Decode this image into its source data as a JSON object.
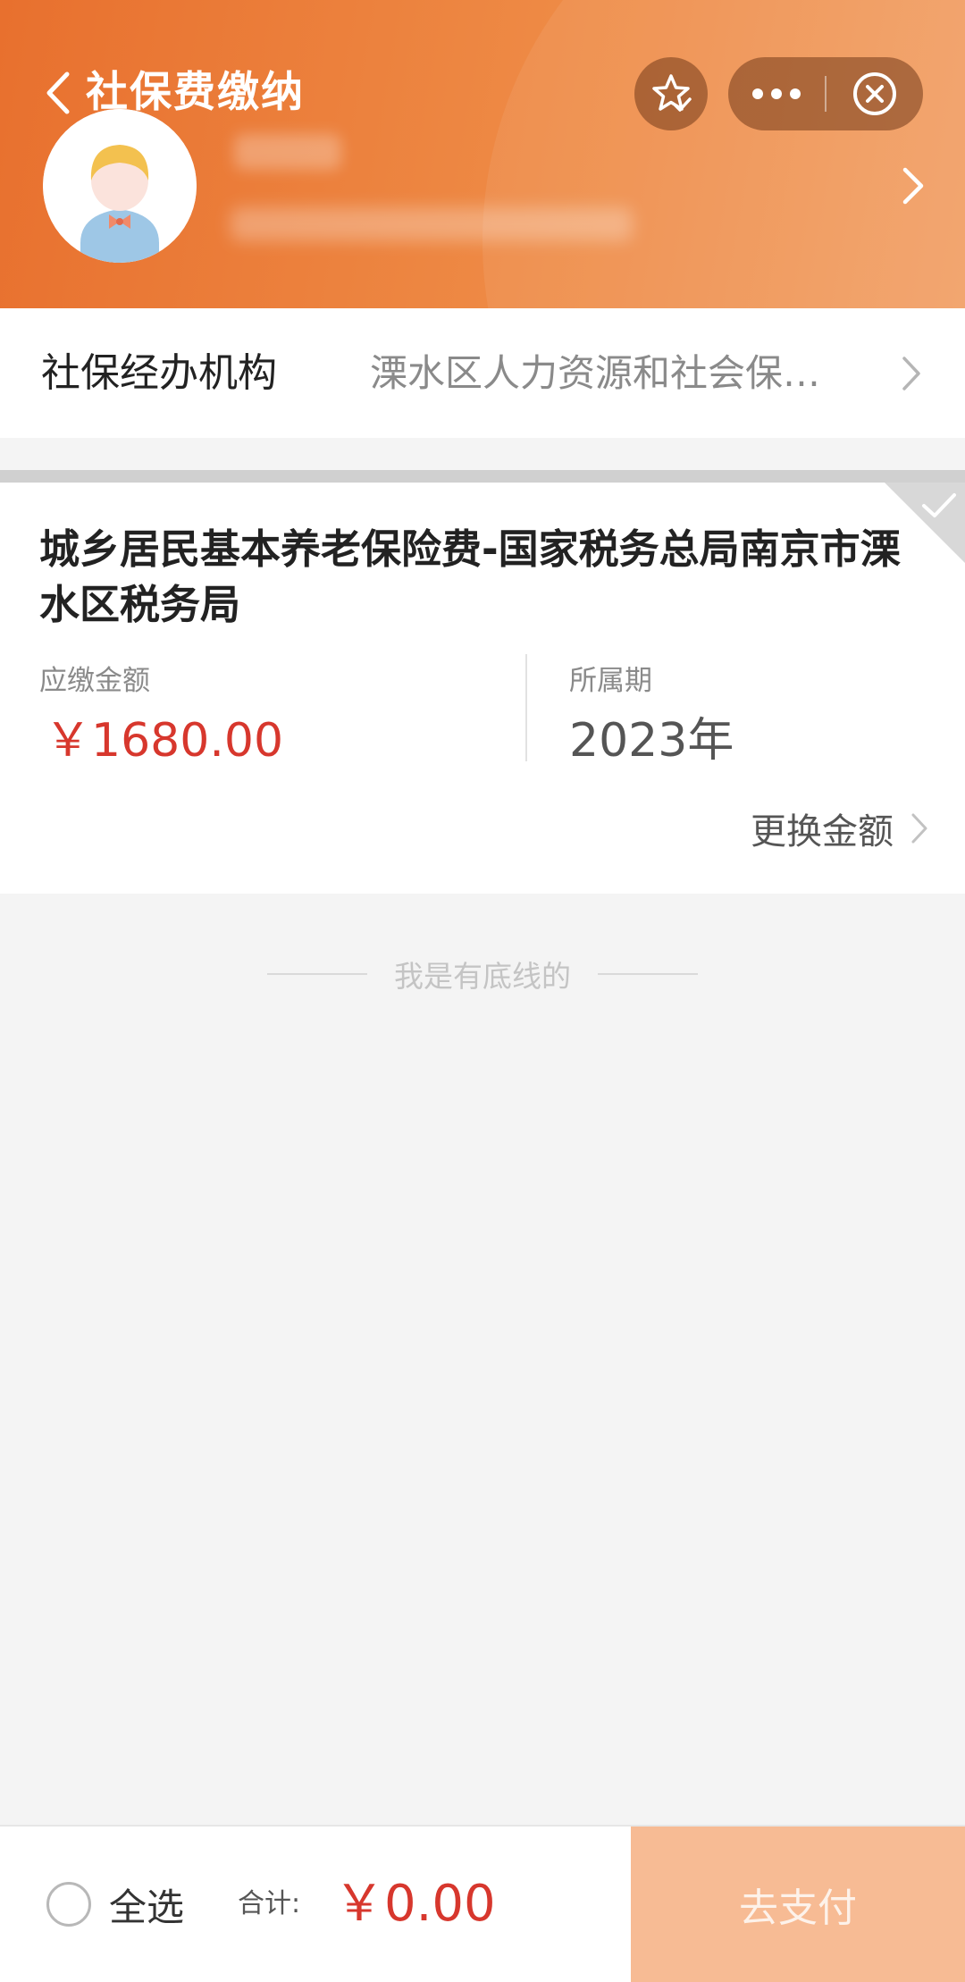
{
  "header": {
    "title": "社保费缴纳",
    "favorite_icon": "star-check-icon",
    "more_icon": "more-dots-icon",
    "close_icon": "close-circle-icon"
  },
  "agency": {
    "label": "社保经办机构",
    "value": "溧水区人力资源和社会保…"
  },
  "fee_card": {
    "title": "城乡居民基本养老保险费-国家税务总局南京市溧水区税务局",
    "amount_label": "应缴金额",
    "amount_value": "￥1680.00",
    "period_label": "所属期",
    "period_value": "2023年",
    "change_amount_label": "更换金额"
  },
  "bottom_line_text": "我是有底线的",
  "footer": {
    "select_all_label": "全选",
    "total_label": "合计:",
    "total_value": "￥0.00",
    "pay_button_label": "去支付"
  },
  "colors": {
    "header_orange": "#e8702e",
    "price_red": "#d7372d",
    "pay_button_disabled": "#f7bb94"
  }
}
